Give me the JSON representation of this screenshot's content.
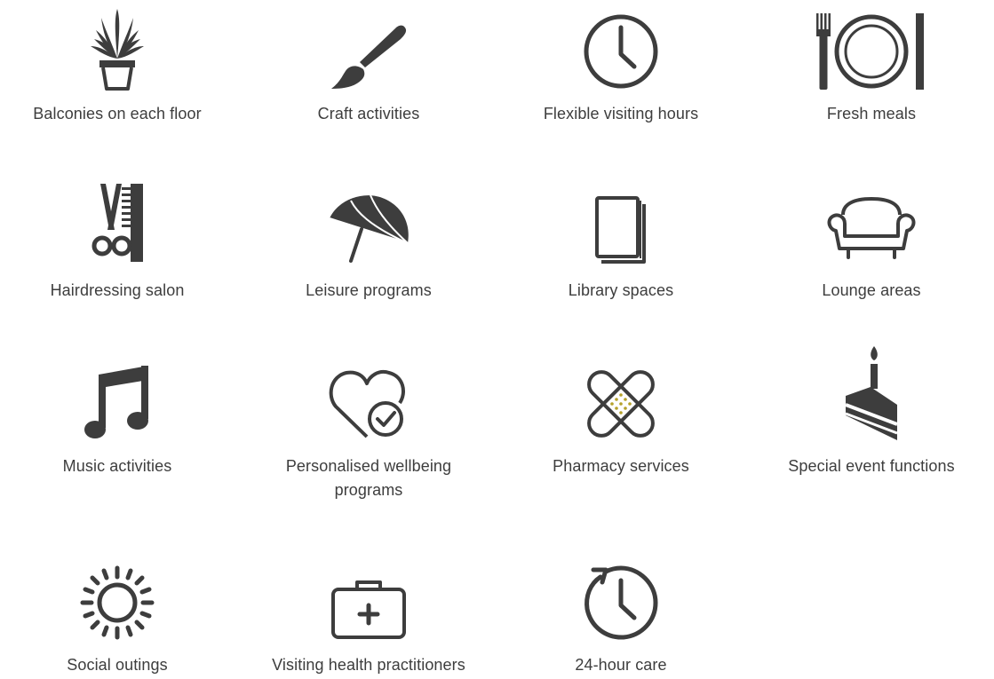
{
  "features": [
    {
      "label": "Balconies on each floor",
      "icon": "potted-plant-icon"
    },
    {
      "label": "Craft activities",
      "icon": "paintbrush-icon"
    },
    {
      "label": "Flexible visiting hours",
      "icon": "clock-icon"
    },
    {
      "label": "Fresh meals",
      "icon": "plate-cutlery-icon"
    },
    {
      "label": "Hairdressing salon",
      "icon": "scissors-comb-icon"
    },
    {
      "label": "Leisure programs",
      "icon": "beach-umbrella-icon"
    },
    {
      "label": "Library spaces",
      "icon": "book-icon"
    },
    {
      "label": "Lounge areas",
      "icon": "armchair-icon"
    },
    {
      "label": "Music activities",
      "icon": "music-note-icon"
    },
    {
      "label": "Personalised wellbeing programs",
      "label_line1": "Personalised wellbeing",
      "label_line2": "programs",
      "icon": "heart-check-icon"
    },
    {
      "label": "Pharmacy services",
      "icon": "bandage-icon"
    },
    {
      "label": "Special event functions",
      "icon": "cake-candle-icon"
    },
    {
      "label": "Social outings",
      "icon": "sun-icon"
    },
    {
      "label": "Visiting health practitioners",
      "icon": "medical-bag-icon"
    },
    {
      "label": "24-hour care",
      "icon": "clock-arrow-icon"
    }
  ],
  "colors": {
    "icon": "#3d3d3d",
    "text": "#3d3d3d",
    "bandage_dots": "#b5a12a",
    "background": "#ffffff"
  }
}
